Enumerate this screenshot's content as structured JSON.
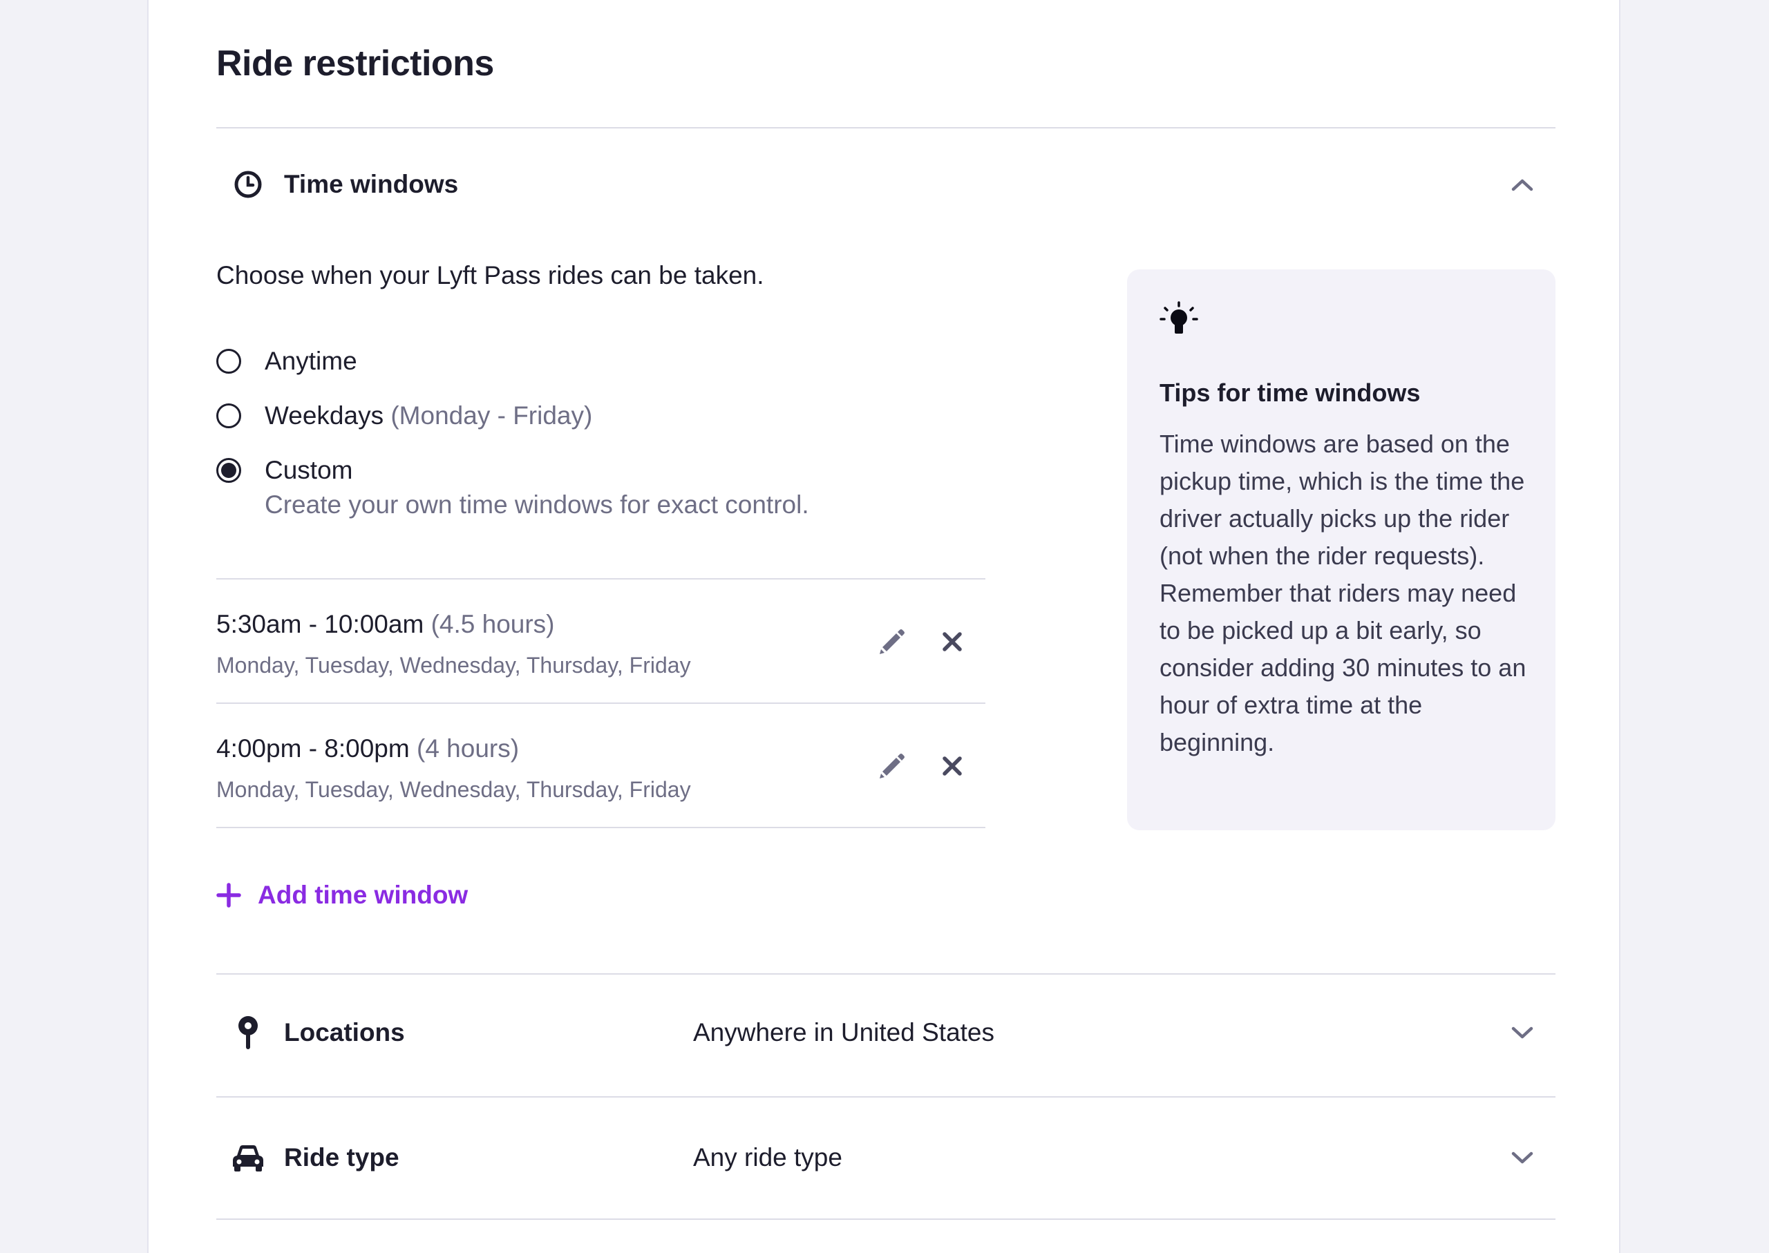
{
  "page": {
    "title": "Ride restrictions"
  },
  "time_windows": {
    "header": "Time windows",
    "icon": "clock-icon",
    "expanded": true,
    "description": "Choose when your Lyft Pass rides can be taken.",
    "options": [
      {
        "label": "Anytime",
        "note": "",
        "selected": false
      },
      {
        "label": "Weekdays",
        "note": "(Monday - Friday)",
        "selected": false
      },
      {
        "label": "Custom",
        "note": "",
        "selected": true
      }
    ],
    "custom_sublabel": "Create your own time windows for exact control.",
    "windows": [
      {
        "time": "5:30am - 10:00am",
        "duration": "(4.5 hours)",
        "days": "Monday, Tuesday, Wednesday, Thursday, Friday"
      },
      {
        "time": "4:00pm - 8:00pm",
        "duration": "(4 hours)",
        "days": "Monday, Tuesday, Wednesday, Thursday, Friday"
      }
    ],
    "add_label": "Add time window",
    "tips": {
      "icon": "lightbulb-icon",
      "title": "Tips for time windows",
      "body": "Time windows are based on the pickup time, which is the time the driver actually picks up the rider (not when the rider requests). Remember that riders may need to be picked up a bit early, so consider adding 30 minutes to an hour of extra time at the beginning."
    }
  },
  "locations": {
    "header": "Locations",
    "icon": "location-pin-icon",
    "value": "Anywhere in United States"
  },
  "ride_type": {
    "header": "Ride type",
    "icon": "car-icon",
    "value": "Any ride type"
  },
  "colors": {
    "accent": "#8a2be2",
    "text": "#1d1d2c",
    "muted": "#6e6e85",
    "tips_bg": "#f3f2f9",
    "page_bg": "#f2f2f7"
  }
}
